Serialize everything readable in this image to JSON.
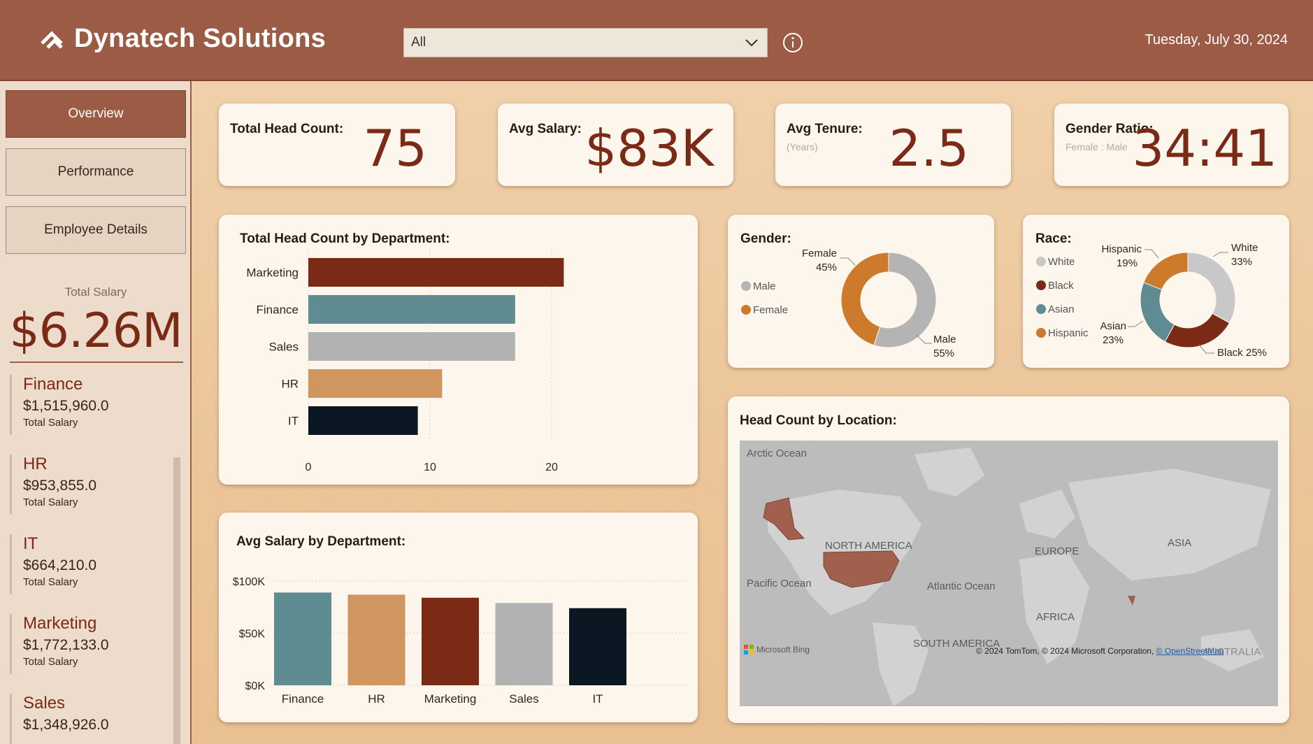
{
  "header": {
    "brand": "Dynatech Solutions",
    "slicer_value": "All",
    "date": "Tuesday, July 30, 2024"
  },
  "sidebar": {
    "nav": [
      {
        "label": "Overview",
        "active": true
      },
      {
        "label": "Performance",
        "active": false
      },
      {
        "label": "Employee Details",
        "active": false
      }
    ],
    "total_salary_label": "Total Salary",
    "total_salary_value": "$6.26M",
    "departments": [
      {
        "name": "Finance",
        "value": "$1,515,960.0",
        "sub": "Total Salary"
      },
      {
        "name": "HR",
        "value": "$953,855.0",
        "sub": "Total Salary"
      },
      {
        "name": "IT",
        "value": "$664,210.0",
        "sub": "Total Salary"
      },
      {
        "name": "Marketing",
        "value": "$1,772,133.0",
        "sub": "Total Salary"
      },
      {
        "name": "Sales",
        "value": "$1,348,926.0",
        "sub": "Total Salary"
      }
    ]
  },
  "kpis": {
    "headcount": {
      "title": "Total Head Count:",
      "value": "75"
    },
    "salary": {
      "title": "Avg Salary:",
      "value": "$83K"
    },
    "tenure": {
      "title": "Avg Tenure:",
      "sub": "(Years)",
      "value": "2.5"
    },
    "gender": {
      "title": "Gender Ratio:",
      "sub": "Female : Male",
      "value": "34:41"
    }
  },
  "panels": {
    "dept_headcount_title": "Total Head Count by Department:",
    "avg_salary_title": "Avg Salary by Department:",
    "gender_title": "Gender:",
    "race_title": "Race:",
    "location_title": "Head Count by Location:"
  },
  "colors": {
    "marketing": "#7a2a15",
    "finance": "#5f8b93",
    "sales": "#b2b2b2",
    "hr": "#cf9660",
    "it": "#0b1824",
    "female": "#cd7a2c",
    "male": "#b4b4b4"
  },
  "chart_data": [
    {
      "type": "bar",
      "orientation": "horizontal",
      "title": "Total Head Count by Department:",
      "categories": [
        "Marketing",
        "Finance",
        "Sales",
        "HR",
        "IT"
      ],
      "values": [
        21,
        17,
        17,
        11,
        9
      ],
      "xticks": [
        "0",
        "10",
        "20"
      ],
      "xlim": [
        0,
        22
      ],
      "grid": true
    },
    {
      "type": "bar",
      "title": "Avg Salary by Department:",
      "categories": [
        "Finance",
        "HR",
        "Marketing",
        "Sales",
        "IT"
      ],
      "values": [
        89000,
        87000,
        84000,
        79000,
        74000
      ],
      "yticks": [
        "$100K",
        "$50K",
        "$0K"
      ],
      "ylim": [
        0,
        100000
      ],
      "grid": true
    },
    {
      "type": "pie",
      "title": "Gender:",
      "labels": [
        "Male",
        "Female"
      ],
      "values": [
        55,
        45
      ],
      "value_labels": [
        "55%",
        "45%"
      ],
      "legend": "left"
    },
    {
      "type": "pie",
      "title": "Race:",
      "labels": [
        "White",
        "Black",
        "Asian",
        "Hispanic"
      ],
      "values": [
        33,
        25,
        23,
        19
      ],
      "value_labels": [
        "33%",
        "25%",
        "23%",
        "19%"
      ],
      "colors": [
        "#c8c8c8",
        "#7a2a15",
        "#5f8b93",
        "#cd7a2c"
      ],
      "legend": "left"
    }
  ],
  "map": {
    "labels": [
      "Arctic Ocean",
      "NORTH AMERICA",
      "EUROPE",
      "ASIA",
      "Pacific Ocean",
      "Atlantic Ocean",
      "AFRICA",
      "SOUTH AMERICA",
      "AUSTRALIA"
    ],
    "bing": "Microsoft Bing",
    "credit": "© 2024 TomTom, © 2024 Microsoft Corporation,",
    "credit_link": "© OpenStreetMap"
  }
}
